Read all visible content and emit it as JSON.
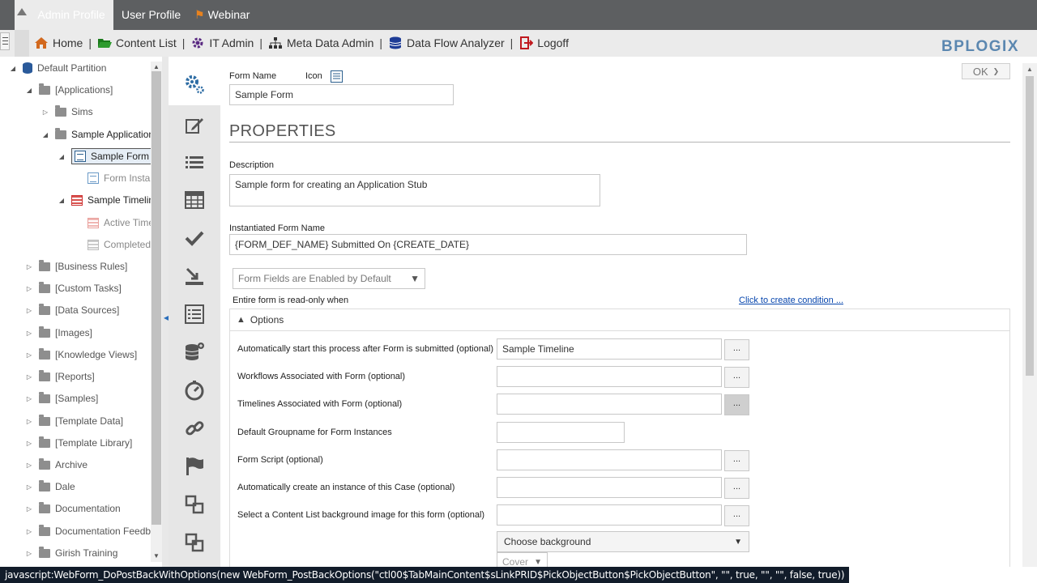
{
  "top_tabs": {
    "admin_profile": "Admin Profile",
    "user_profile": "User Profile",
    "webinar": "Webinar"
  },
  "nav": {
    "home": "Home",
    "content_list": "Content List",
    "it_admin": "IT Admin",
    "meta_data_admin": "Meta Data Admin",
    "data_flow_analyzer": "Data Flow Analyzer",
    "logoff": "Logoff",
    "separator": "|"
  },
  "logo": "BPLOGIX",
  "tree": {
    "root": "Default Partition",
    "applications": "[Applications]",
    "sims": "Sims",
    "sample_application": "Sample Application",
    "sample_form": "Sample Form",
    "form_instances": "Form Instances",
    "sample_timeline": "Sample Timeline",
    "active_timelines": "Active Timelines",
    "completed": "Completed",
    "business_rules": "[Business Rules]",
    "custom_tasks": "[Custom Tasks]",
    "data_sources": "[Data Sources]",
    "images": "[Images]",
    "knowledge_views": "[Knowledge Views]",
    "reports": "[Reports]",
    "samples": "[Samples]",
    "template_data": "[Template Data]",
    "template_library": "[Template Library]",
    "archive": "Archive",
    "dale": "Dale",
    "documentation": "Documentation",
    "documentation_feedback": "Documentation Feedback",
    "girish_training": "Girish Training"
  },
  "form": {
    "ok_label": "OK",
    "form_name_label": "Form Name",
    "icon_label": "Icon",
    "form_name_value": "Sample Form",
    "properties_title": "PROPERTIES",
    "description_label": "Description",
    "description_value": "Sample form for creating an Application Stub",
    "instantiated_label": "Instantiated Form Name",
    "instantiated_value": "{FORM_DEF_NAME} Submitted On {CREATE_DATE}",
    "fields_enabled_select": "Form Fields are Enabled by Default",
    "readonly_label": "Entire form is read-only when",
    "create_condition_link": "Click to create condition ...",
    "options_title": "Options",
    "rows": {
      "auto_start_label": "Automatically start this process after Form is submitted (optional)",
      "auto_start_value": "Sample Timeline",
      "workflows_label": "Workflows Associated with Form (optional)",
      "timelines_label": "Timelines Associated with Form (optional)",
      "groupname_label": "Default Groupname for Form Instances",
      "script_label": "Form Script (optional)",
      "auto_case_label": "Automatically create an instance of this Case (optional)",
      "background_label": "Select a Content List background image for this form (optional)"
    },
    "ellipsis": "...",
    "choose_background": "Choose background",
    "cover_select": "Cover"
  },
  "status_text": "javascript:WebForm_DoPostBackWithOptions(new WebForm_PostBackOptions(\"ctl00$TabMainContent$sLinkPRID$PickObjectButton$PickObjectButton\", \"\", true, \"\", \"\", false, true))",
  "colors": {
    "topbar": "#5d5f61",
    "accent_blue": "#2a6ebb",
    "logo_blue": "#5b87b0",
    "link_blue": "#0645ad"
  }
}
